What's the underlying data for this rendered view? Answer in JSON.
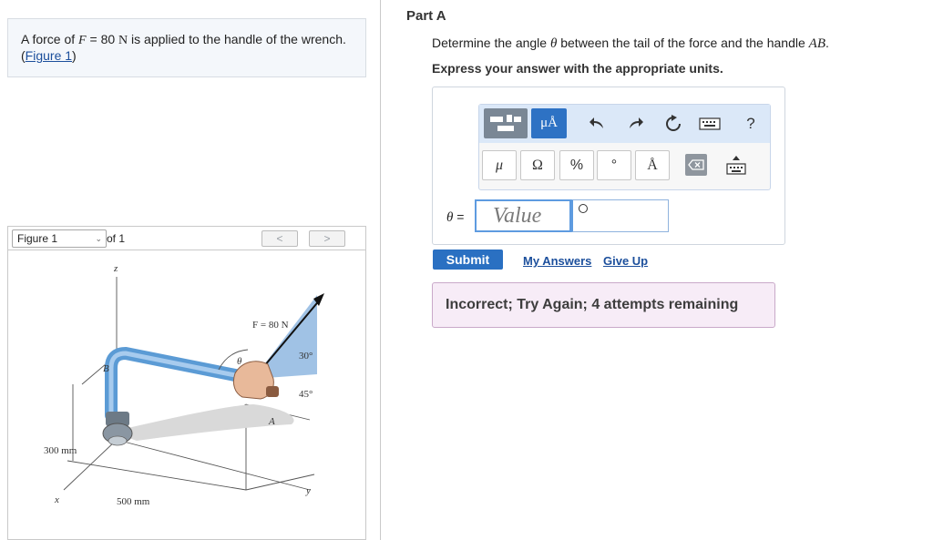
{
  "problem": {
    "text_before": "A force of ",
    "var_f": "F",
    "text_eq": " = 80 ",
    "unit_n": "N",
    "text_after": " is applied to the handle of the wrench.",
    "link_open": "(",
    "figure_link": "Figure 1",
    "link_close": ")"
  },
  "figure": {
    "selector_value": "Figure 1",
    "of_text": "of 1",
    "prev": "<",
    "next": ">",
    "labels": {
      "z": "z",
      "force": "F = 80 N",
      "angle30": "30°",
      "angle45": "45°",
      "theta": "θ",
      "b": "B",
      "a": "A",
      "dim300": "300 mm",
      "dim500": "500 mm",
      "x": "x",
      "y": "y"
    }
  },
  "part": {
    "title": "Part A",
    "question_before": "Determine the angle ",
    "question_theta": "θ",
    "question_after": " between the tail of the force and the handle ",
    "question_ab": "AB",
    "question_end": ".",
    "instruction": "Express your answer with the appropriate units."
  },
  "toolbar": {
    "units_label": "μÅ",
    "help": "?",
    "symbols": {
      "mu": "μ",
      "ohm": "Ω",
      "percent": "%",
      "degree": "°",
      "angstrom": "Å"
    },
    "icons": [
      "templates-icon",
      "units-icon",
      "undo-icon",
      "redo-icon",
      "reset-icon",
      "keyboard-icon",
      "help-icon",
      "backspace-icon",
      "keyboard-toggle-icon"
    ]
  },
  "answer": {
    "label_theta": "θ",
    "label_eq": " =",
    "value_placeholder": "Value",
    "units_value": ""
  },
  "actions": {
    "submit": "Submit",
    "my_answers": "My Answers",
    "give_up": "Give Up"
  },
  "feedback": {
    "text": "Incorrect; Try Again; 4 attempts remaining"
  },
  "colors": {
    "accent_blue": "#2a70c2",
    "link_blue": "#1c4f9c",
    "feedback_bg": "#f7ecf7",
    "feedback_border": "#c9a9c9",
    "toolbar_top": "#dbe8f8"
  }
}
